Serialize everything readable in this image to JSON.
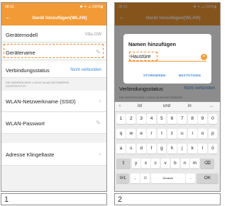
{
  "panel1": {
    "status": {
      "time": "08:15",
      "right": "✱ ᯤ ⊿ 100%▮"
    },
    "header": {
      "back": "←",
      "title": "Gerät hinzufügen(WLAN)"
    },
    "rows": {
      "model": {
        "label": "Gerätemodell",
        "value": "Villa-GW"
      },
      "name": {
        "label": "Gerätename",
        "icon": "✎"
      },
      "status": {
        "label": "Verbindungsstatus",
        "value": "Nicht verbunden"
      },
      "hint": "DIE WERDEN NUR 2.4GHZ WLAN NETZWERKE UNTERSTÜTZT",
      "ssid": {
        "label": "WLAN-Netzwerkname (SSID)",
        "icon": "›"
      },
      "password": {
        "label": "WLAN-Passwort",
        "icon": "✎"
      },
      "bell": {
        "label": "Adresse Klingeltaste",
        "icon": "›"
      }
    },
    "number": "1"
  },
  "panel2": {
    "status": {
      "time": "08:15",
      "right": "✱ ᯤ ⊿ 100%▮"
    },
    "header": {
      "back": "←",
      "title": "Gerät hinzufügen(WLAN)"
    },
    "dialog": {
      "title": "Namen hinzufügen",
      "input_value": "Haustüre",
      "clear_icon": "✕",
      "cancel": "STORNIEREN",
      "confirm": "BESTÄTIGEN"
    },
    "behind": {
      "label": "Verbindungsstatus",
      "value": "Nicht verbunden",
      "hint": "DIE WERDEN NUR 2.4GHZ WLAN NETZWERKE"
    },
    "keyboard": {
      "suggestions": [
        "‹",
        "ist",
        "und",
        "in",
        "…"
      ],
      "row1": [
        "1",
        "2",
        "3",
        "4",
        "5",
        "6",
        "7",
        "8",
        "9",
        "0"
      ],
      "row2": [
        "q",
        "w",
        "e",
        "r",
        "t",
        "z",
        "u",
        "i",
        "o",
        "p"
      ],
      "row3": [
        "a",
        "s",
        "d",
        "f",
        "g",
        "h",
        "j",
        "k",
        "l",
        "ö"
      ],
      "row4": [
        "⇧",
        "y",
        "x",
        "c",
        "v",
        "b",
        "n",
        "m",
        "⌫"
      ],
      "row5": [
        "!#1",
        ",",
        "☺",
        "Deutsch",
        ".",
        "OK"
      ]
    },
    "number": "2"
  },
  "colors": {
    "accent": "#f29a35",
    "link": "#3a86d8",
    "dashed_highlight": "#f0862a"
  }
}
